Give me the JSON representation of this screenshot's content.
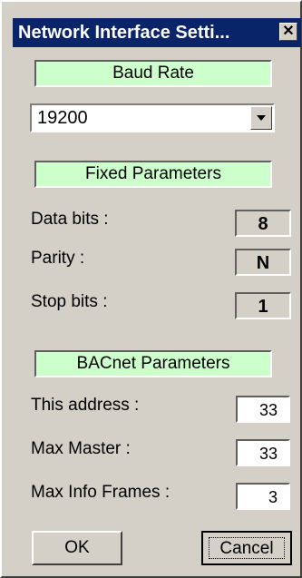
{
  "window": {
    "title": "Network Interface Setti...",
    "close_glyph": "✕"
  },
  "baud": {
    "header": "Baud Rate",
    "value": "19200"
  },
  "fixed": {
    "header": "Fixed Parameters",
    "rows": [
      {
        "label": "Data bits :",
        "value": "8"
      },
      {
        "label": "Parity :",
        "value": "N"
      },
      {
        "label": "Stop bits :",
        "value": "1"
      }
    ]
  },
  "bacnet": {
    "header": "BACnet Parameters",
    "rows": [
      {
        "label": "This address :",
        "value": "33"
      },
      {
        "label": "Max Master :",
        "value": "33"
      },
      {
        "label": "Max Info Frames :",
        "value": "3"
      }
    ]
  },
  "buttons": {
    "ok": "OK",
    "cancel": "Cancel"
  },
  "colors": {
    "titlebar": "#0a246a",
    "header_fill": "#ccffcc",
    "dialog_bg": "#d4d0c8"
  }
}
